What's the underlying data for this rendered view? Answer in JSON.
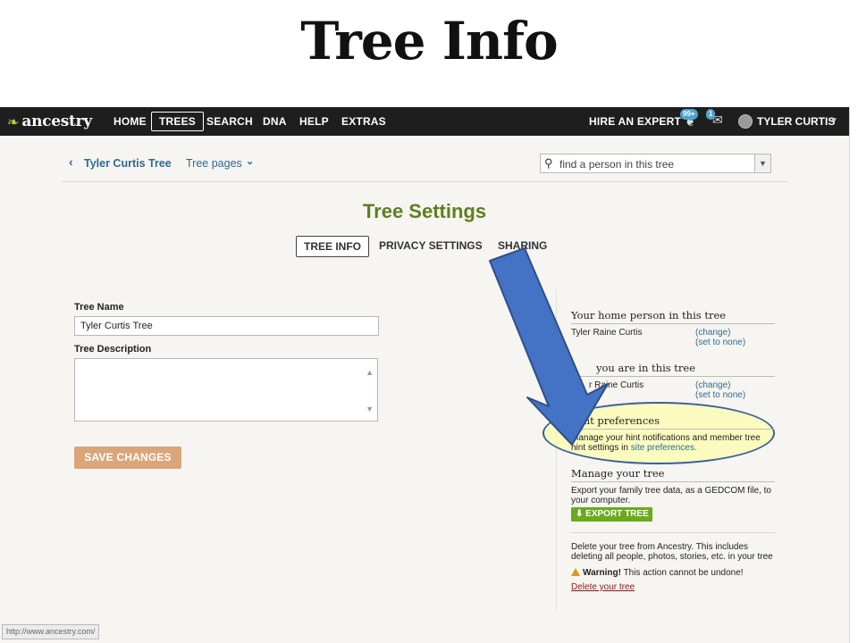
{
  "slide": {
    "title": "Tree Info"
  },
  "nav": {
    "logo": "ancestry",
    "items": [
      "HOME",
      "TREES",
      "SEARCH",
      "DNA",
      "HELP",
      "EXTRAS"
    ],
    "hire": "HIRE AN EXPERT",
    "hint_badge": "99+",
    "mail_badge": "1",
    "user": "TYLER CURTIS"
  },
  "subnav": {
    "back_label": "Tyler Curtis Tree",
    "pages_label": "Tree pages",
    "search_placeholder": "find a person in this tree"
  },
  "page": {
    "heading": "Tree Settings",
    "tabs": [
      "TREE INFO",
      "PRIVACY SETTINGS",
      "SHARING"
    ]
  },
  "form": {
    "name_label": "Tree Name",
    "name_value": "Tyler Curtis Tree",
    "desc_label": "Tree Description",
    "save_label": "SAVE CHANGES"
  },
  "sidebar": {
    "home_heading": "Your home person in this tree",
    "home_name": "Tyler Raine Curtis",
    "change": "(change)",
    "set_none": "(set to none)",
    "you_heading": "you are in this tree",
    "you_name": "r Raine Curtis",
    "hint_heading": "Hint preferences",
    "hint_text": "Manage your hint notifications and member tree hint settings in",
    "hint_link": "site preferences.",
    "manage_heading": "Manage your tree",
    "export_text": "Export your family tree data, as a GEDCOM file, to your computer.",
    "export_label": "EXPORT TREE",
    "delete_text": "Delete your tree from Ancestry. This includes deleting all people, photos, stories, etc. in your tree",
    "warning_label": "Warning!",
    "warning_text": "This action cannot be undone!",
    "delete_link": "Delete your tree"
  },
  "status": {
    "url": "http://www.ancestry.com/"
  },
  "colors": {
    "accent_green": "#5f7f1e",
    "link_blue": "#2e6a8e",
    "save_button": "#d9a67a",
    "export_button": "#6aaa1e",
    "highlight": "#ffff96",
    "arrow": "#4472c4"
  }
}
